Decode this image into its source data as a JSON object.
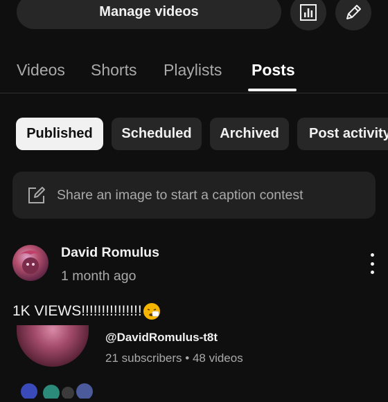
{
  "actions": {
    "manage_videos": "Manage videos",
    "analytics_icon": "bar-chart-icon",
    "edit_icon": "pencil-icon"
  },
  "tabs": [
    {
      "label": "Videos",
      "active": false
    },
    {
      "label": "Shorts",
      "active": false
    },
    {
      "label": "Playlists",
      "active": false
    },
    {
      "label": "Posts",
      "active": true
    }
  ],
  "chips": [
    {
      "label": "Published",
      "selected": true
    },
    {
      "label": "Scheduled",
      "selected": false
    },
    {
      "label": "Archived",
      "selected": false
    },
    {
      "label": "Post activity",
      "selected": false
    }
  ],
  "composer": {
    "placeholder": "Share an image to start a caption contest",
    "icon": "edit-square-icon"
  },
  "post": {
    "author": "David Romulus",
    "time": "1 month ago",
    "text": "1K VIEWS!!!!!!!!!!!!!!!",
    "emoji": "sneezing-face-emoji"
  },
  "shared_channel": {
    "handle": "@DavidRomulus-t8t",
    "stats": "21 subscribers • 48 videos"
  },
  "colors": {
    "background": "#0f0f0f",
    "surface": "#272727",
    "text_primary": "#f1f1f1",
    "text_secondary": "#aaaaaa"
  }
}
